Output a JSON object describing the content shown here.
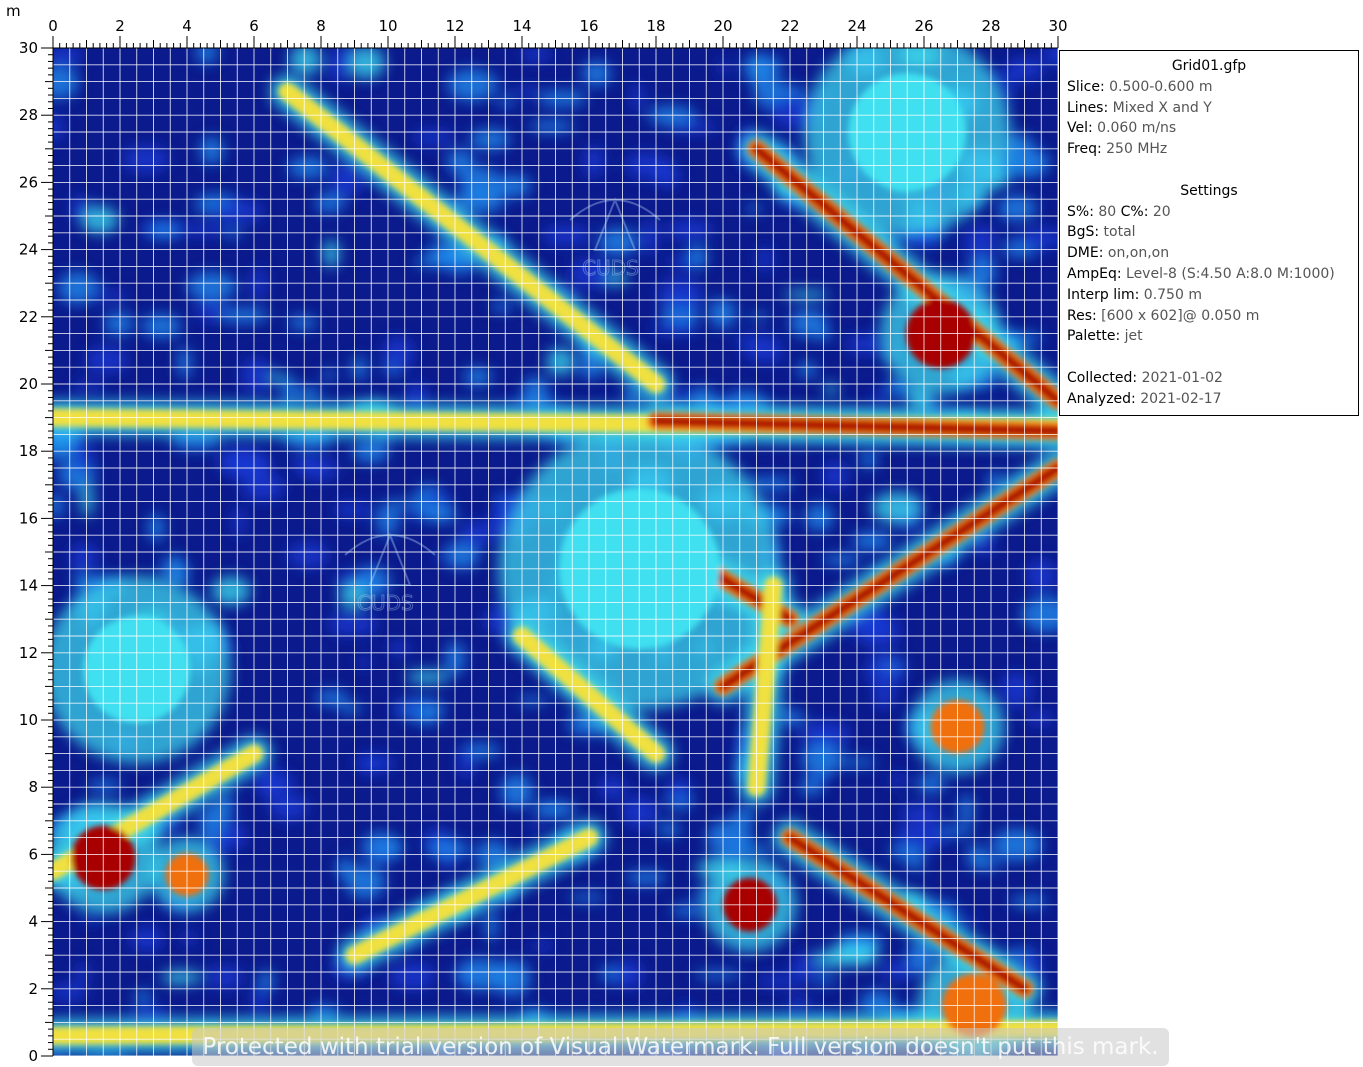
{
  "chart_data": {
    "type": "heatmap",
    "title": "",
    "xlabel": "",
    "ylabel": "m",
    "xlim": [
      0,
      30
    ],
    "ylim": [
      0,
      30
    ],
    "x_ticks": [
      "0",
      "2",
      "4",
      "6",
      "8",
      "10",
      "12",
      "14",
      "16",
      "18",
      "20",
      "22",
      "24",
      "26",
      "28",
      "30"
    ],
    "y_ticks": [
      "0",
      "2",
      "4",
      "6",
      "8",
      "10",
      "12",
      "14",
      "16",
      "18",
      "20",
      "22",
      "24",
      "26",
      "28",
      "30"
    ],
    "grid": true,
    "grid_color": "#ffffff",
    "palette": [
      "#0b1a8c",
      "#1a3bd6",
      "#1f8ff0",
      "#3fe0f0",
      "#f0e040",
      "#f07010",
      "#a80000"
    ],
    "features": [
      {
        "kind": "line",
        "from": [
          0,
          19
        ],
        "to": [
          30,
          18.7
        ],
        "intensity": 0.7
      },
      {
        "kind": "line",
        "from": [
          18,
          18.9
        ],
        "to": [
          30,
          18.6
        ],
        "intensity": 1.0
      },
      {
        "kind": "line",
        "from": [
          7,
          28.7
        ],
        "to": [
          18,
          20
        ],
        "intensity": 0.85
      },
      {
        "kind": "line",
        "from": [
          21,
          27
        ],
        "to": [
          30,
          19.5
        ],
        "intensity": 0.95
      },
      {
        "kind": "line",
        "from": [
          17,
          16
        ],
        "to": [
          22,
          13
        ],
        "intensity": 0.95
      },
      {
        "kind": "line",
        "from": [
          20,
          11
        ],
        "to": [
          30,
          17.5
        ],
        "intensity": 1.0
      },
      {
        "kind": "line",
        "from": [
          21.5,
          14
        ],
        "to": [
          21,
          8
        ],
        "intensity": 0.85
      },
      {
        "kind": "line",
        "from": [
          14,
          12.5
        ],
        "to": [
          18,
          9
        ],
        "intensity": 0.85
      },
      {
        "kind": "line",
        "from": [
          9,
          3
        ],
        "to": [
          16,
          6.5
        ],
        "intensity": 0.8
      },
      {
        "kind": "line",
        "from": [
          0,
          5.5
        ],
        "to": [
          6,
          9
        ],
        "intensity": 0.75
      },
      {
        "kind": "line",
        "from": [
          22,
          6.5
        ],
        "to": [
          29,
          2
        ],
        "intensity": 0.9
      },
      {
        "kind": "line",
        "from": [
          0,
          0.6
        ],
        "to": [
          30,
          0.8
        ],
        "intensity": 0.7
      },
      {
        "kind": "blob",
        "at": [
          1.5,
          5.9
        ],
        "r": 1.2,
        "intensity": 1.0
      },
      {
        "kind": "blob",
        "at": [
          4,
          5.4
        ],
        "r": 0.8,
        "intensity": 0.9
      },
      {
        "kind": "blob",
        "at": [
          20.8,
          4.5
        ],
        "r": 1.0,
        "intensity": 1.0
      },
      {
        "kind": "blob",
        "at": [
          27,
          9.8
        ],
        "r": 1.0,
        "intensity": 0.9
      },
      {
        "kind": "blob",
        "at": [
          26.5,
          21.5
        ],
        "r": 1.3,
        "intensity": 1.0
      },
      {
        "kind": "blob",
        "at": [
          27.5,
          1.5
        ],
        "r": 1.2,
        "intensity": 0.9
      },
      {
        "kind": "blob",
        "at": [
          2.5,
          11.5
        ],
        "r": 2.0,
        "intensity": 0.5
      },
      {
        "kind": "blob",
        "at": [
          25.5,
          27.5
        ],
        "r": 2.2,
        "intensity": 0.45
      },
      {
        "kind": "blob",
        "at": [
          17.5,
          14.5
        ],
        "r": 3.0,
        "intensity": 0.45
      }
    ]
  },
  "axis_unit_label": "m",
  "info": {
    "title": "Grid01.gfp",
    "rows": [
      {
        "k": "Slice:",
        "v": "0.500-0.600 m"
      },
      {
        "k": "Lines:",
        "v": "Mixed X and Y"
      },
      {
        "k": "Vel:",
        "v": "0.060 m/ns"
      },
      {
        "k": "Freq:",
        "v": "250 MHz"
      }
    ],
    "settings_title": "Settings",
    "settings_rows": [
      {
        "k": "S%:",
        "v": "80",
        "k2": "C%:",
        "v2": "20"
      },
      {
        "k": "BgS:",
        "v": "total"
      },
      {
        "k": "DME:",
        "v": "on,on,on"
      },
      {
        "k": "AmpEq:",
        "v": "Level-8 (S:4.50 A:8.0 M:1000)"
      },
      {
        "k": "Interp lim:",
        "v": "0.750 m"
      },
      {
        "k": "Res:",
        "v": "[600 x 602]@ 0.050 m"
      },
      {
        "k": "Palette:",
        "v": "jet"
      }
    ],
    "date_rows": [
      {
        "k": "Collected:",
        "v": "2021-01-02"
      },
      {
        "k": "Analyzed:",
        "v": "2021-02-17"
      }
    ]
  },
  "logo_text": "CUDS",
  "watermark_banner": "Protected with trial version of Visual Watermark. Full version doesn't put this mark."
}
